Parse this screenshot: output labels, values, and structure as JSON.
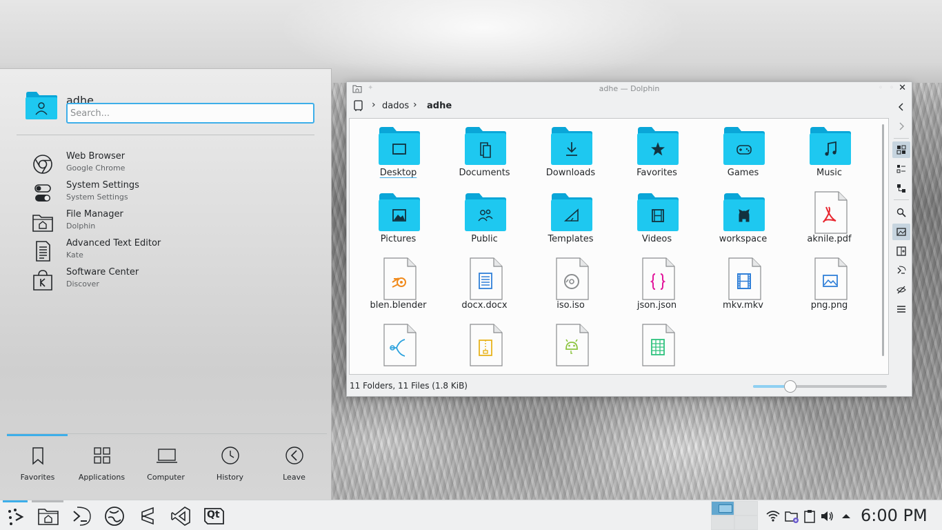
{
  "launcher": {
    "user_name": "adhe",
    "search_placeholder": "Search...",
    "favorites": [
      {
        "title": "Web Browser",
        "subtitle": "Google Chrome",
        "icon": "chrome-icon"
      },
      {
        "title": "System Settings",
        "subtitle": "System Settings",
        "icon": "settings-icon"
      },
      {
        "title": "File Manager",
        "subtitle": "Dolphin",
        "icon": "file-manager-icon"
      },
      {
        "title": "Advanced Text Editor",
        "subtitle": "Kate",
        "icon": "text-editor-icon"
      },
      {
        "title": "Software Center",
        "subtitle": "Discover",
        "icon": "software-center-icon"
      }
    ],
    "tabs": [
      {
        "label": "Favorites",
        "icon": "bookmark-icon"
      },
      {
        "label": "Applications",
        "icon": "grid-icon"
      },
      {
        "label": "Computer",
        "icon": "laptop-icon"
      },
      {
        "label": "History",
        "icon": "clock-icon"
      },
      {
        "label": "Leave",
        "icon": "back-arrow-icon"
      }
    ]
  },
  "dolphin": {
    "title": "adhe — Dolphin",
    "close_glyph": "✕",
    "breadcrumb": [
      "dados",
      "adhe"
    ],
    "items": [
      {
        "name": "Desktop",
        "kind": "folder",
        "glyph": "desktop-icon"
      },
      {
        "name": "Documents",
        "kind": "folder",
        "glyph": "documents-icon"
      },
      {
        "name": "Downloads",
        "kind": "folder",
        "glyph": "download-icon"
      },
      {
        "name": "Favorites",
        "kind": "folder",
        "glyph": "star-icon"
      },
      {
        "name": "Games",
        "kind": "folder",
        "glyph": "gamepad-icon"
      },
      {
        "name": "Music",
        "kind": "folder",
        "glyph": "music-note-icon"
      },
      {
        "name": "Pictures",
        "kind": "folder",
        "glyph": "image-icon"
      },
      {
        "name": "Public",
        "kind": "folder",
        "glyph": "users-icon"
      },
      {
        "name": "Templates",
        "kind": "folder",
        "glyph": "ruler-icon"
      },
      {
        "name": "Videos",
        "kind": "folder",
        "glyph": "film-icon"
      },
      {
        "name": "workspace",
        "kind": "folder",
        "glyph": "github-icon"
      },
      {
        "name": "aknile.pdf",
        "kind": "file",
        "glyph": "pdf-icon",
        "color": "#e8262f"
      },
      {
        "name": "blen.blender",
        "kind": "file",
        "glyph": "blender-icon",
        "color": "#f08a1c"
      },
      {
        "name": "docx.docx",
        "kind": "file",
        "glyph": "document-icon",
        "color": "#2f7fd8"
      },
      {
        "name": "iso.iso",
        "kind": "file",
        "glyph": "disc-icon",
        "color": "#8a8d8f"
      },
      {
        "name": "json.json",
        "kind": "file",
        "glyph": "json-icon",
        "color": "#e2179b"
      },
      {
        "name": "mkv.mkv",
        "kind": "file",
        "glyph": "film-file-icon",
        "color": "#2f7fd8"
      },
      {
        "name": "png.png",
        "kind": "file",
        "glyph": "picture-file-icon",
        "color": "#2f7fd8"
      },
      {
        "name": "",
        "kind": "file",
        "glyph": "vector-icon",
        "color": "#2aa1dd"
      },
      {
        "name": "",
        "kind": "file",
        "glyph": "archive-icon",
        "color": "#e8b31c"
      },
      {
        "name": "",
        "kind": "file",
        "glyph": "android-icon",
        "color": "#8cc43f"
      },
      {
        "name": "",
        "kind": "file",
        "glyph": "spreadsheet-icon",
        "color": "#2ec27e"
      }
    ],
    "status": "11 Folders, 11 Files (1.8 KiB)",
    "zoom_level": 0.28
  },
  "panel": {
    "launchers": [
      "app-launcher-icon",
      "file-manager-icon",
      "terminal-icon",
      "browser-icon",
      "sublime-text-icon",
      "visual-studio-icon",
      "qt-creator-icon"
    ],
    "qt_label": "Qt",
    "tray": [
      "wifi-icon",
      "folder-sync-icon",
      "clipboard-icon",
      "volume-icon",
      "expand-tray-icon"
    ],
    "clock": "6:00 PM"
  },
  "colors": {
    "accent": "#3daee9",
    "folder": "#1ec8f0",
    "folder_dark": "#0aa6d8"
  }
}
